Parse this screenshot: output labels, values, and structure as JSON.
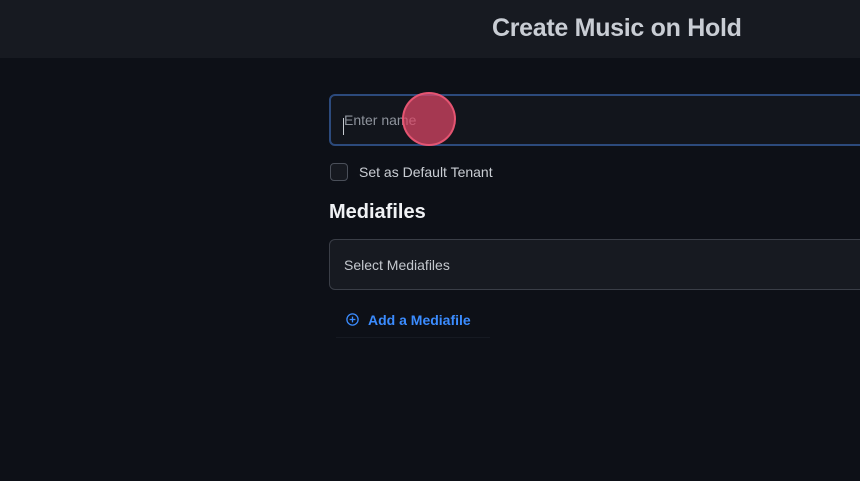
{
  "header": {
    "title": "Create Music on Hold"
  },
  "form": {
    "name_field": {
      "placeholder": "Enter name",
      "value": ""
    },
    "default_tenant": {
      "label": "Set as Default Tenant",
      "checked": false
    },
    "mediafiles": {
      "section_title": "Mediafiles",
      "select_placeholder": "Select Mediafiles",
      "add_label": "Add a Mediafile",
      "add_icon": "plus-circle-icon"
    }
  },
  "colors": {
    "background": "#0d1017",
    "header": "#171a21",
    "accent": "#3b8cff",
    "input_focus_border": "#2c4a7c",
    "cursor_highlight": "#de4666"
  }
}
